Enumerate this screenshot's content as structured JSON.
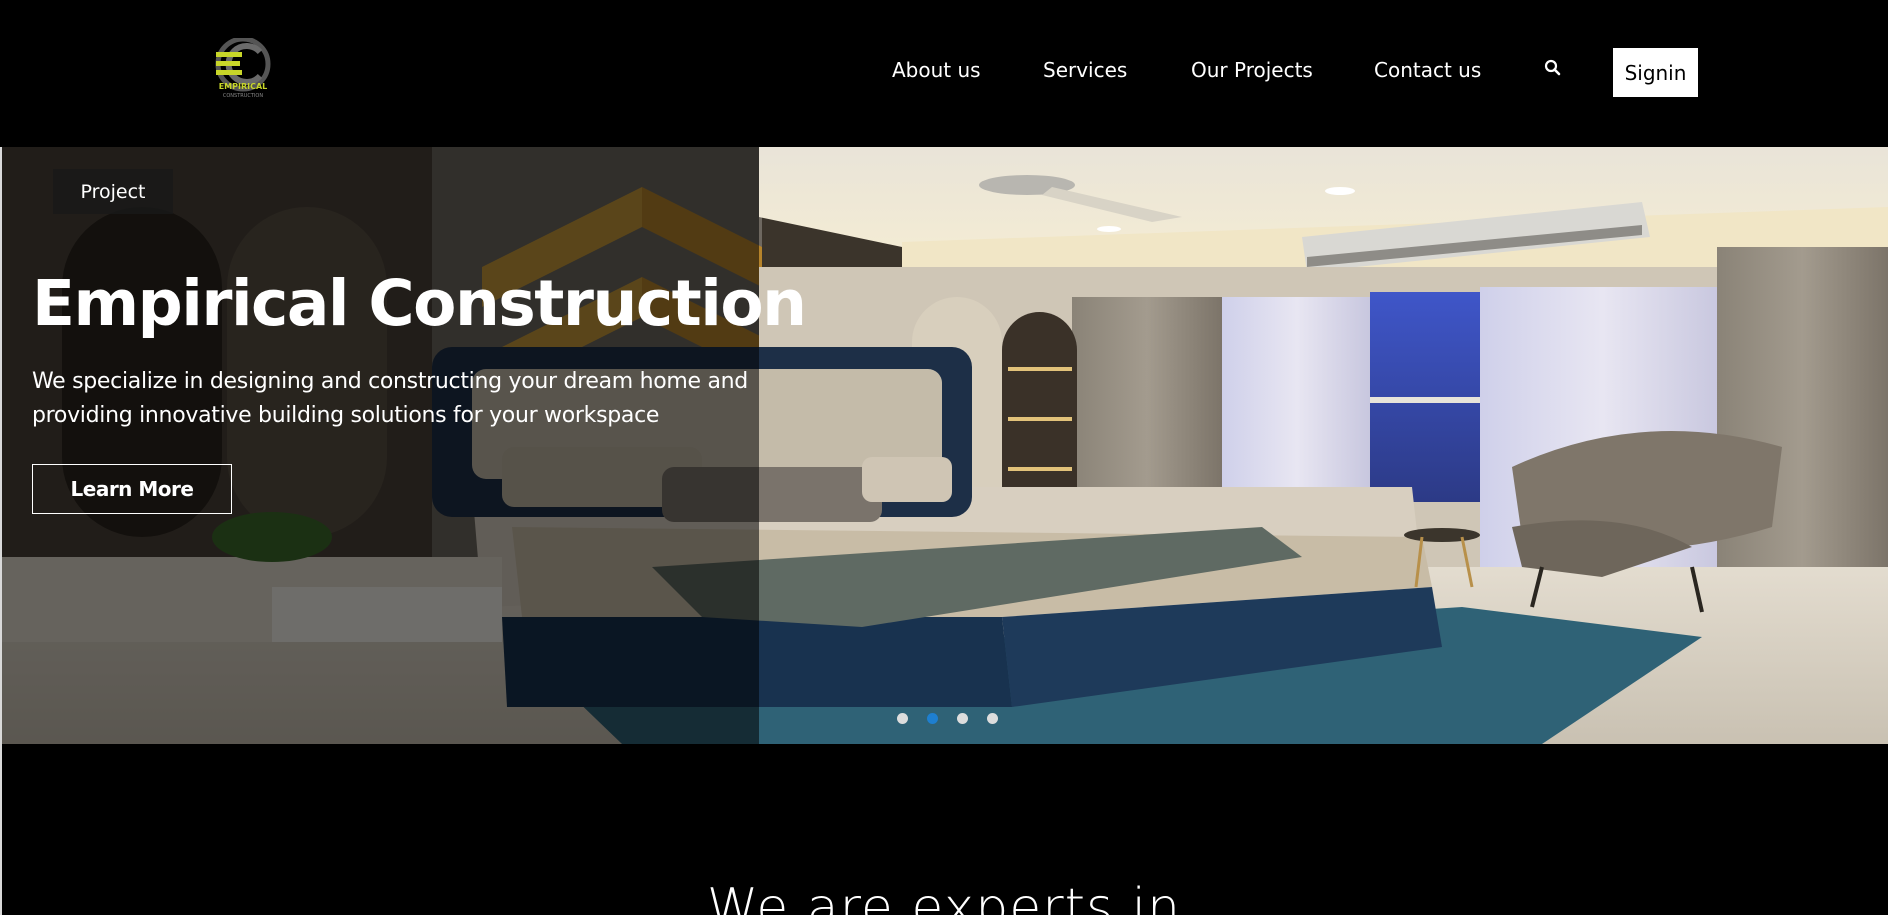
{
  "brand": {
    "logo_text": "EMPIRICAL",
    "logo_subtext": "CONSTRUCTION",
    "accent_color": "#c8d629"
  },
  "nav": {
    "items": [
      {
        "label": "About us"
      },
      {
        "label": "Services"
      },
      {
        "label": "Our Projects"
      },
      {
        "label": "Contact us"
      }
    ],
    "search_icon": "search-icon",
    "signin_label": "Signin"
  },
  "hero": {
    "tag": "Project",
    "title": "Empirical Construction",
    "text": "We specialize in designing and constructing your dream home and providing innovative building solutions for your workspace",
    "cta_label": "Learn More",
    "slides_total": 4,
    "active_slide": 2,
    "active_dot_color": "#1e7fd0"
  },
  "section": {
    "heading": "We are experts in"
  }
}
